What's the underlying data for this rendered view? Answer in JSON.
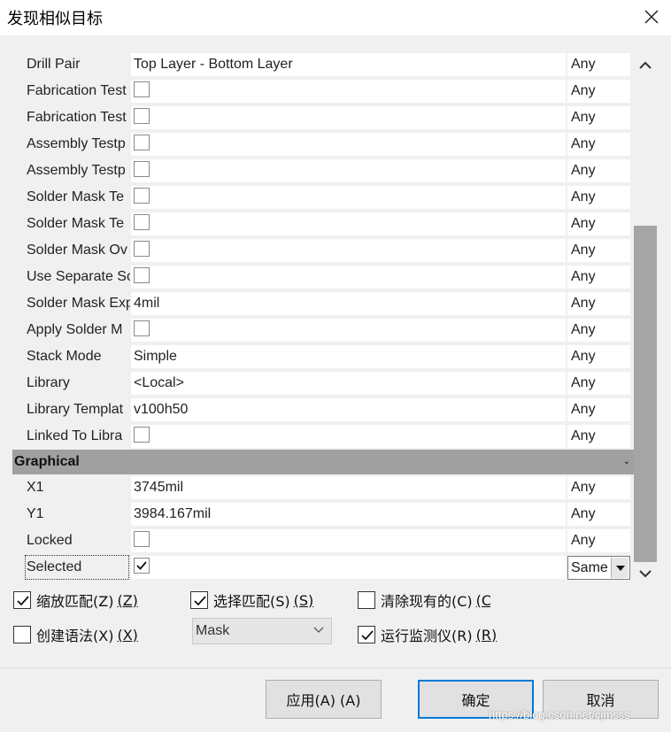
{
  "window": {
    "title": "发现相似目标"
  },
  "rows": [
    {
      "name": "Drill Pair",
      "kind": "text",
      "value": "Top Layer - Bottom Layer",
      "match": "Any"
    },
    {
      "name": "Fabrication Test",
      "kind": "check",
      "checked": false,
      "match": "Any"
    },
    {
      "name": "Fabrication Test",
      "kind": "check",
      "checked": false,
      "match": "Any"
    },
    {
      "name": "Assembly Testp",
      "kind": "check",
      "checked": false,
      "match": "Any"
    },
    {
      "name": "Assembly Testp",
      "kind": "check",
      "checked": false,
      "match": "Any"
    },
    {
      "name": "Solder Mask Te",
      "kind": "check",
      "checked": false,
      "match": "Any"
    },
    {
      "name": "Solder Mask Te",
      "kind": "check",
      "checked": false,
      "match": "Any"
    },
    {
      "name": "Solder Mask Ov",
      "kind": "check",
      "checked": false,
      "match": "Any"
    },
    {
      "name": "Use Separate Sc",
      "kind": "check",
      "checked": false,
      "match": "Any"
    },
    {
      "name": "Solder Mask Exp",
      "kind": "text",
      "value": "4mil",
      "match": "Any"
    },
    {
      "name": "Apply Solder M",
      "kind": "check",
      "checked": false,
      "match": "Any"
    },
    {
      "name": "Stack Mode",
      "kind": "text",
      "value": "Simple",
      "match": "Any"
    },
    {
      "name": "Library",
      "kind": "text",
      "value": "<Local>",
      "match": "Any"
    },
    {
      "name": "Library Templat",
      "kind": "text",
      "value": "v100h50",
      "match": "Any"
    },
    {
      "name": "Linked To Libra",
      "kind": "check",
      "checked": false,
      "match": "Any"
    }
  ],
  "group": {
    "label": "Graphical",
    "toggle": "⌄"
  },
  "graphical_rows": [
    {
      "name": "X1",
      "kind": "text",
      "value": "3745mil",
      "match": "Any"
    },
    {
      "name": "Y1",
      "kind": "text",
      "value": "3984.167mil",
      "match": "Any"
    },
    {
      "name": "Locked",
      "kind": "check",
      "checked": false,
      "match": "Any"
    },
    {
      "name": "Selected",
      "kind": "check",
      "checked": true,
      "match": "Same"
    }
  ],
  "options": {
    "zoom_match": {
      "label": "缩放匹配(Z)",
      "accel": "(Z)",
      "checked": true
    },
    "select_match": {
      "label": "选择匹配(S)",
      "accel": "(S)",
      "checked": true
    },
    "clear_existing": {
      "label": "清除现有的(C)",
      "accel": "(C",
      "checked": false
    },
    "create_expression": {
      "label": "创建语法(X)",
      "accel": "(X)",
      "checked": false
    },
    "mask_combo": {
      "value": "Mask"
    },
    "run_inspector": {
      "label": "运行监测仪(R)",
      "accel": "(R)",
      "checked": true
    }
  },
  "buttons": {
    "apply": "应用(A) (A)",
    "ok": "确定",
    "cancel": "取消"
  },
  "watermark": "https://blog.csdn.net/cjmsss"
}
